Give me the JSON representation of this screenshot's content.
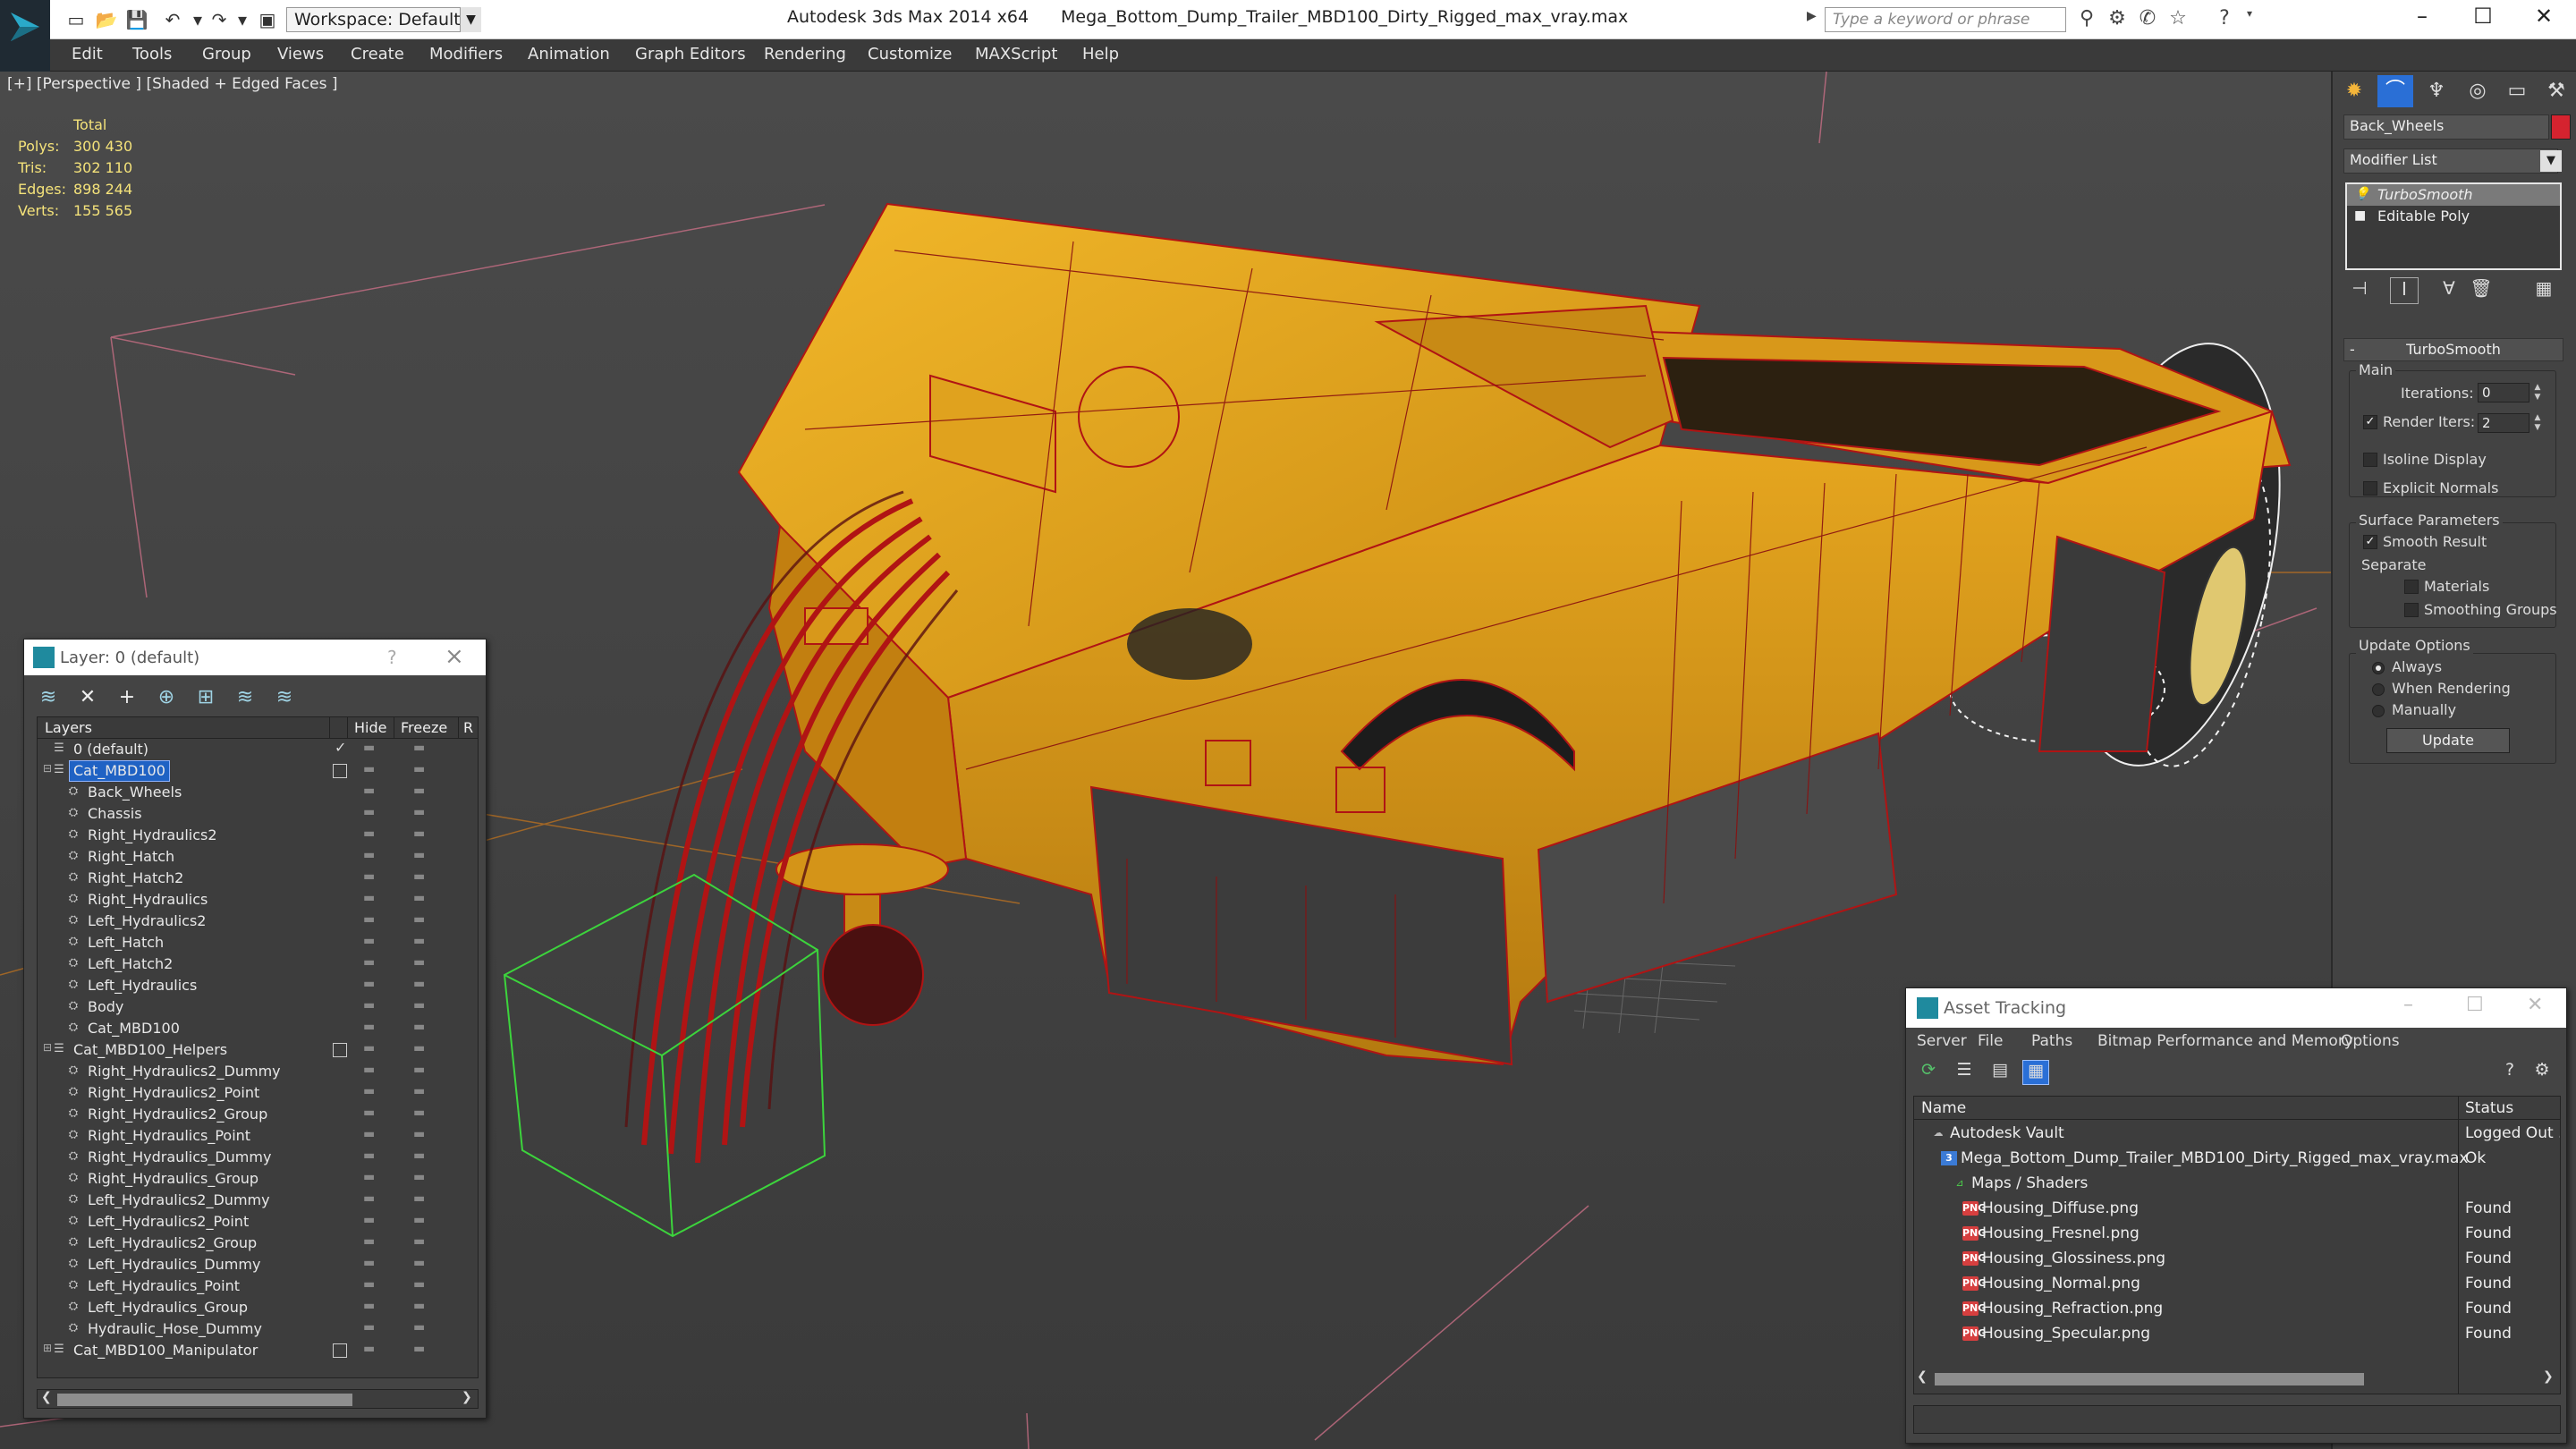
{
  "titlebar": {
    "workspace": "Workspace: Default",
    "app_name": "Autodesk 3ds Max 2014 x64",
    "file_name": "Mega_Bottom_Dump_Trailer_MBD100_Dirty_Rigged_max_vray.max",
    "search_placeholder": "Type a keyword or phrase"
  },
  "menu": [
    "Edit",
    "Tools",
    "Group",
    "Views",
    "Create",
    "Modifiers",
    "Animation",
    "Graph Editors",
    "Rendering",
    "Customize",
    "MAXScript",
    "Help"
  ],
  "viewport": {
    "label": "[+] [Perspective ] [Shaded + Edged Faces ]",
    "stats_header": "Total",
    "stats": [
      {
        "k": "Polys:",
        "v": "300 430"
      },
      {
        "k": "Tris:",
        "v": "302 110"
      },
      {
        "k": "Edges:",
        "v": "898 244"
      },
      {
        "k": "Verts:",
        "v": "155 565"
      }
    ]
  },
  "command_panel": {
    "object_name": "Back_Wheels",
    "object_color": "#d5232f",
    "modifier_list": "Modifier List",
    "stack": [
      "TurboSmooth",
      "Editable Poly"
    ],
    "rollout_title": "TurboSmooth",
    "main_group": "Main",
    "iterations_label": "Iterations:",
    "iterations_value": "0",
    "render_iters_label": "Render Iters:",
    "render_iters_value": "2",
    "isoline_label": "Isoline Display",
    "explicit_normals_label": "Explicit Normals",
    "surface_group": "Surface Parameters",
    "smooth_result_label": "Smooth Result",
    "separate_label": "Separate",
    "materials_label": "Materials",
    "smoothing_groups_label": "Smoothing Groups",
    "update_group": "Update Options",
    "always_label": "Always",
    "when_rendering_label": "When Rendering",
    "manually_label": "Manually",
    "update_button": "Update"
  },
  "layer_window": {
    "title": "Layer: 0 (default)",
    "help": "?",
    "columns": {
      "layers": "Layers",
      "hide": "Hide",
      "freeze": "Freeze",
      "render": "R"
    },
    "rows": [
      {
        "name": "0 (default)",
        "level": 0,
        "type": "layer",
        "check": true
      },
      {
        "name": "Cat_MBD100",
        "level": 0,
        "type": "layer",
        "selected": true,
        "box": true,
        "expander": "⊟"
      },
      {
        "name": "Back_Wheels",
        "level": 1,
        "type": "object"
      },
      {
        "name": "Chassis",
        "level": 1,
        "type": "object"
      },
      {
        "name": "Right_Hydraulics2",
        "level": 1,
        "type": "object"
      },
      {
        "name": "Right_Hatch",
        "level": 1,
        "type": "object"
      },
      {
        "name": "Right_Hatch2",
        "level": 1,
        "type": "object"
      },
      {
        "name": "Right_Hydraulics",
        "level": 1,
        "type": "object"
      },
      {
        "name": "Left_Hydraulics2",
        "level": 1,
        "type": "object"
      },
      {
        "name": "Left_Hatch",
        "level": 1,
        "type": "object"
      },
      {
        "name": "Left_Hatch2",
        "level": 1,
        "type": "object"
      },
      {
        "name": "Left_Hydraulics",
        "level": 1,
        "type": "object"
      },
      {
        "name": "Body",
        "level": 1,
        "type": "object"
      },
      {
        "name": "Cat_MBD100",
        "level": 1,
        "type": "object"
      },
      {
        "name": "Cat_MBD100_Helpers",
        "level": 0,
        "type": "layer",
        "box": true,
        "expander": "⊟"
      },
      {
        "name": "Right_Hydraulics2_Dummy",
        "level": 1,
        "type": "object"
      },
      {
        "name": "Right_Hydraulics2_Point",
        "level": 1,
        "type": "object"
      },
      {
        "name": "Right_Hydraulics2_Group",
        "level": 1,
        "type": "object"
      },
      {
        "name": "Right_Hydraulics_Point",
        "level": 1,
        "type": "object"
      },
      {
        "name": "Right_Hydraulics_Dummy",
        "level": 1,
        "type": "object"
      },
      {
        "name": "Right_Hydraulics_Group",
        "level": 1,
        "type": "object"
      },
      {
        "name": "Left_Hydraulics2_Dummy",
        "level": 1,
        "type": "object"
      },
      {
        "name": "Left_Hydraulics2_Point",
        "level": 1,
        "type": "object"
      },
      {
        "name": "Left_Hydraulics2_Group",
        "level": 1,
        "type": "object"
      },
      {
        "name": "Left_Hydraulics_Dummy",
        "level": 1,
        "type": "object"
      },
      {
        "name": "Left_Hydraulics_Point",
        "level": 1,
        "type": "object"
      },
      {
        "name": "Left_Hydraulics_Group",
        "level": 1,
        "type": "object"
      },
      {
        "name": "Hydraulic_Hose_Dummy",
        "level": 1,
        "type": "object"
      },
      {
        "name": "Cat_MBD100_Manipulator",
        "level": 0,
        "type": "layer",
        "box": true,
        "expander": "⊞"
      }
    ]
  },
  "asset_window": {
    "title": "Asset Tracking",
    "menu": [
      "Server",
      "File",
      "Paths",
      "Bitmap Performance and Memory",
      "Options"
    ],
    "columns": {
      "name": "Name",
      "status": "Status"
    },
    "rows": [
      {
        "name": "Autodesk Vault",
        "status": "Logged Out ...",
        "indent": 0,
        "icon": "vault"
      },
      {
        "name": "Mega_Bottom_Dump_Trailer_MBD100_Dirty_Rigged_max_vray.max",
        "status": "Ok",
        "indent": 1,
        "icon": "max"
      },
      {
        "name": "Maps / Shaders",
        "status": "",
        "indent": 2,
        "icon": "maps"
      },
      {
        "name": "Housing_Diffuse.png",
        "status": "Found",
        "indent": 3,
        "icon": "png"
      },
      {
        "name": "Housing_Fresnel.png",
        "status": "Found",
        "indent": 3,
        "icon": "png"
      },
      {
        "name": "Housing_Glossiness.png",
        "status": "Found",
        "indent": 3,
        "icon": "png"
      },
      {
        "name": "Housing_Normal.png",
        "status": "Found",
        "indent": 3,
        "icon": "png"
      },
      {
        "name": "Housing_Refraction.png",
        "status": "Found",
        "indent": 3,
        "icon": "png"
      },
      {
        "name": "Housing_Specular.png",
        "status": "Found",
        "indent": 3,
        "icon": "png"
      }
    ]
  },
  "colors": {
    "model_yellow": "#e6a51c",
    "wire_red": "#b01414",
    "selection_blue": "#1f62c4",
    "stats_yellow": "#f4e27a"
  }
}
